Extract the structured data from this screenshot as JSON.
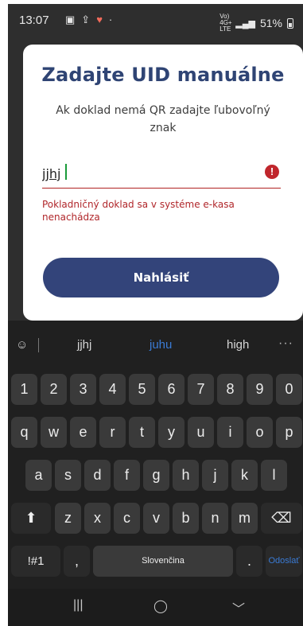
{
  "status_bar": {
    "time": "13:07",
    "left_icons": [
      "image-icon",
      "upload-icon",
      "heart-icon",
      "dot-icon"
    ],
    "network_label": "Vo) 4G+ LTE",
    "battery": "51%"
  },
  "dialog": {
    "title": "Zadajte UID manuálne",
    "subtitle": "Ak doklad nemá QR zadajte ľubovoľný znak",
    "input_value": "jjhj",
    "error_message": "Pokladničný doklad sa v systéme e-kasa nenachádza",
    "submit_label": "Nahlásiť"
  },
  "keyboard": {
    "suggestions": [
      "jjhj",
      "juhu",
      "high"
    ],
    "number_row": [
      "1",
      "2",
      "3",
      "4",
      "5",
      "6",
      "7",
      "8",
      "9",
      "0"
    ],
    "row_q": [
      "q",
      "w",
      "e",
      "r",
      "t",
      "y",
      "u",
      "i",
      "o",
      "p"
    ],
    "row_a": [
      "a",
      "s",
      "d",
      "f",
      "g",
      "h",
      "j",
      "k",
      "l"
    ],
    "row_z": [
      "z",
      "x",
      "c",
      "v",
      "b",
      "n",
      "m"
    ],
    "symbols_label": "!#1",
    "comma_label": ",",
    "space_label": "Slovenčina",
    "period_label": ".",
    "action_label": "Odoslať"
  },
  "colors": {
    "brand": "#33447a",
    "error": "#c0262c",
    "suggestion_active": "#3a7bd5"
  }
}
